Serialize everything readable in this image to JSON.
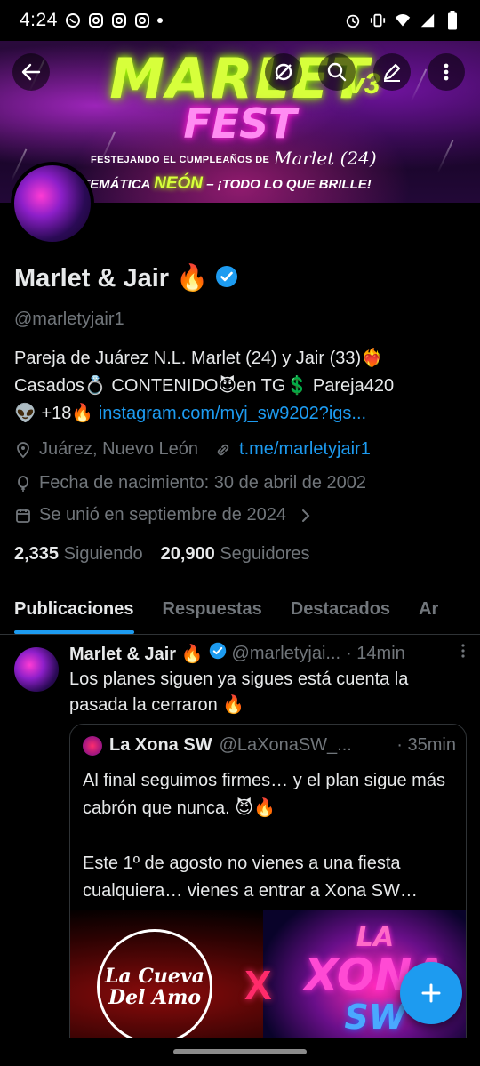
{
  "status_bar": {
    "time": "4:24",
    "left_icons": [
      "whatsapp-icon",
      "instagram-icon",
      "instagram-icon",
      "instagram-icon",
      "dot-icon"
    ],
    "right_icons": [
      "alarm-icon",
      "vibrate-icon",
      "wifi-icon",
      "signal-icon",
      "battery-icon"
    ]
  },
  "banner": {
    "title": "MARLET",
    "vs": "v3",
    "fest": "FEST",
    "subtitle": "FESTEJANDO EL CUMPLEAÑOS DE",
    "script_name": "Marlet (24)",
    "theme_prefix": "TEMÁTICA",
    "theme_neon": "NEÓN",
    "theme_suffix": "– ¡TODO LO QUE BRILLE!"
  },
  "profile": {
    "name": "Marlet & Jair 🔥",
    "handle": "@marletyjair1",
    "bio_line1": "Pareja de Juárez N.L. Marlet (24) y Jair (33)❤️‍🔥",
    "bio_line2": "Casados💍 CONTENIDO😈en TG💲 Pareja420",
    "bio_line3_prefix": "👽 +18🔥 ",
    "bio_link": "instagram.com/myj_sw9202?igs...",
    "location": "Juárez, Nuevo León",
    "website": "t.me/marletyjair1",
    "birthday": "Fecha de nacimiento: 30 de abril de 2002",
    "joined": "Se unió en septiembre de 2024",
    "following_count": "2,335",
    "following_label": "Siguiendo",
    "followers_count": "20,900",
    "followers_label": "Seguidores"
  },
  "tabs": [
    {
      "label": "Publicaciones",
      "active": true
    },
    {
      "label": "Respuestas",
      "active": false
    },
    {
      "label": "Destacados",
      "active": false
    },
    {
      "label": "Ar",
      "active": false
    }
  ],
  "tweet": {
    "name": "Marlet & Jair 🔥",
    "handle": "@marletyjai...",
    "time": "· 14min",
    "text": "Los planes siguen ya sigues está cuenta la pasada la cerraron 🔥",
    "quote": {
      "name": "La Xona SW",
      "handle": "@LaXonaSW_...",
      "time": "· 35min",
      "text_line1": "Al final seguimos firmes… y el plan sigue más cabrón que nunca. 😈🔥",
      "text_line2": "Este 1º de agosto no vienes a una fiesta cualquiera… vienes a entrar a Xona SW…",
      "image_left": "La Cueva Del Amo",
      "image_x": "X",
      "image_right_la": "LA",
      "image_right_xona": "XONA",
      "image_right_sw": "SW"
    }
  },
  "colors": {
    "accent": "#1d9bf0",
    "text_primary": "#e7e9ea",
    "text_secondary": "#71767b",
    "background": "#000000",
    "divider": "#2f3336"
  }
}
